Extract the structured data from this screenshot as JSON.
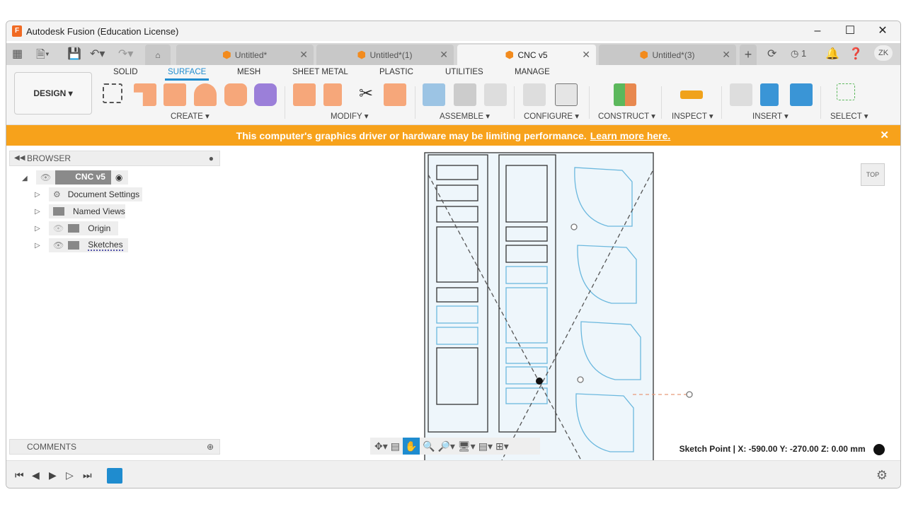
{
  "window": {
    "title": "Autodesk Fusion (Education License)",
    "logo_letter": "F"
  },
  "tabs": [
    {
      "label": "Untitled*",
      "active": false
    },
    {
      "label": "Untitled*(1)",
      "active": false
    },
    {
      "label": "CNC v5",
      "active": true
    },
    {
      "label": "Untitled*(3)",
      "active": false
    }
  ],
  "header": {
    "job_count": "1",
    "user_initials": "ZK"
  },
  "ribbon": {
    "workspace": "DESIGN",
    "tabs": [
      "SOLID",
      "SURFACE",
      "MESH",
      "SHEET METAL",
      "PLASTIC",
      "UTILITIES",
      "MANAGE"
    ],
    "active_tab": "SURFACE",
    "groups": [
      "CREATE",
      "MODIFY",
      "ASSEMBLE",
      "CONFIGURE",
      "CONSTRUCT",
      "INSPECT",
      "INSERT",
      "SELECT"
    ]
  },
  "banner": {
    "message": "This computer's graphics driver or hardware may be limiting performance.",
    "link": "Learn more here."
  },
  "browser": {
    "title": "BROWSER",
    "root": "CNC v5",
    "items": [
      "Document Settings",
      "Named Views",
      "Origin",
      "Sketches"
    ]
  },
  "comments": {
    "title": "COMMENTS"
  },
  "viewcube": {
    "face": "TOP"
  },
  "status": {
    "text": "Sketch Point | X: -590.00 Y: -270.00 Z: 0.00 mm"
  },
  "colors": {
    "accent": "#1f8ccf",
    "banner": "#f7a21b",
    "sketch": "#6bb8de"
  }
}
